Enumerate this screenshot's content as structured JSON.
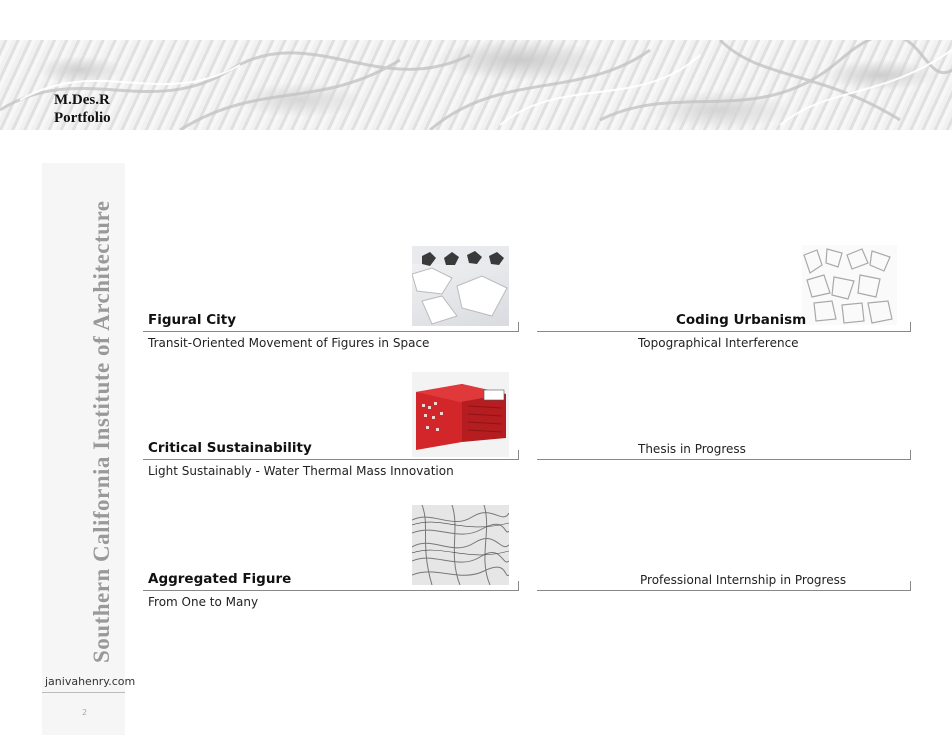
{
  "header": {
    "title_line1": "M.Des.R",
    "title_line2": "Portfolio"
  },
  "sidebar": {
    "school": "Southern California Institute of Architecture",
    "website": "janivahenry.com",
    "page_number": "2"
  },
  "projects": [
    {
      "title": "Figural City",
      "subtitle": "Transit-Oriented Movement of Figures in Space"
    },
    {
      "title": "Coding Urbanism",
      "subtitle": "Topographical Interference"
    },
    {
      "title": "Critical Sustainability",
      "subtitle": "Light Sustainably - Water Thermal Mass Innovation"
    },
    {
      "title": "",
      "subtitle": "Thesis in Progress"
    },
    {
      "title": "Aggregated Figure",
      "subtitle": "From One to Many"
    },
    {
      "title": "",
      "subtitle": "Professional Internship in Progress"
    }
  ],
  "colors": {
    "accent_red": "#d3262a",
    "sidebar_bg": "#f6f6f6",
    "sidebar_text": "#999999"
  }
}
